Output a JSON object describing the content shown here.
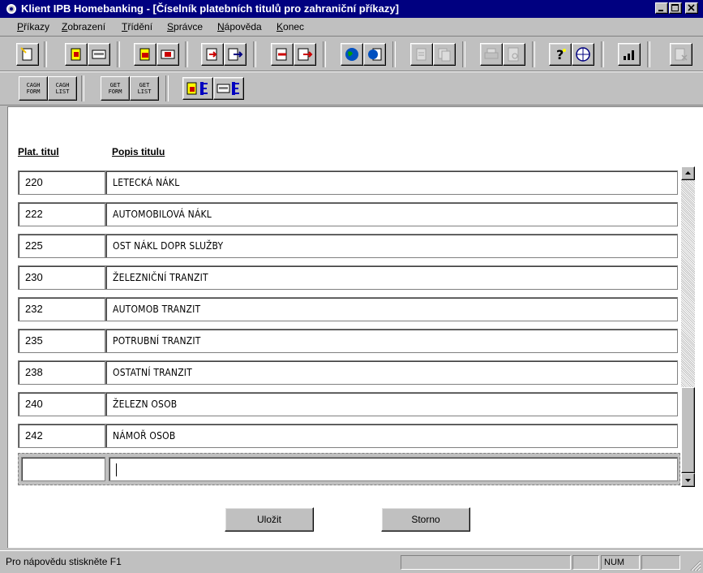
{
  "window": {
    "title": "Klient IPB Homebanking - [Číselník platebních titulů pro zahraniční příkazy]"
  },
  "menu": [
    {
      "label": "Příkazy",
      "accel": "P"
    },
    {
      "label": "Zobrazení",
      "accel": "Z"
    },
    {
      "label": "Třídění",
      "accel": "T"
    },
    {
      "label": "Správce",
      "accel": "S"
    },
    {
      "label": "Nápověda",
      "accel": "N"
    },
    {
      "label": "Konec",
      "accel": "K"
    }
  ],
  "toolbar2": {
    "btn1": {
      "l1": "CAGH",
      "l2": "FORM"
    },
    "btn2": {
      "l1": "CAGH",
      "l2": "LIST"
    },
    "btn3": {
      "l1": "GET",
      "l2": "FORM"
    },
    "btn4": {
      "l1": "GET",
      "l2": "LIST"
    }
  },
  "table": {
    "col_code": "Plat. titul",
    "col_desc": "Popis titulu",
    "rows": [
      {
        "code": "220",
        "desc": "LETECKÁ NÁKL"
      },
      {
        "code": "222",
        "desc": "AUTOMOBILOVÁ NÁKL"
      },
      {
        "code": "225",
        "desc": "OST NÁKL DOPR SLUŽBY"
      },
      {
        "code": "230",
        "desc": "ŽELEZNIČNÍ TRANZIT"
      },
      {
        "code": "232",
        "desc": "AUTOMOB TRANZIT"
      },
      {
        "code": "235",
        "desc": "POTRUBNÍ TRANZIT"
      },
      {
        "code": "238",
        "desc": "OSTATNÍ TRANZIT"
      },
      {
        "code": "240",
        "desc": "ŽELEZN OSOB"
      },
      {
        "code": "242",
        "desc": "NÁMOŘ OSOB"
      },
      {
        "code": "",
        "desc": ""
      }
    ]
  },
  "buttons": {
    "save": "Uložit",
    "cancel": "Storno"
  },
  "status": {
    "help_text": "Pro nápovědu stiskněte F1",
    "num": "NUM"
  },
  "colors": {
    "title_bar": "#000080",
    "face": "#c0c0c0"
  }
}
